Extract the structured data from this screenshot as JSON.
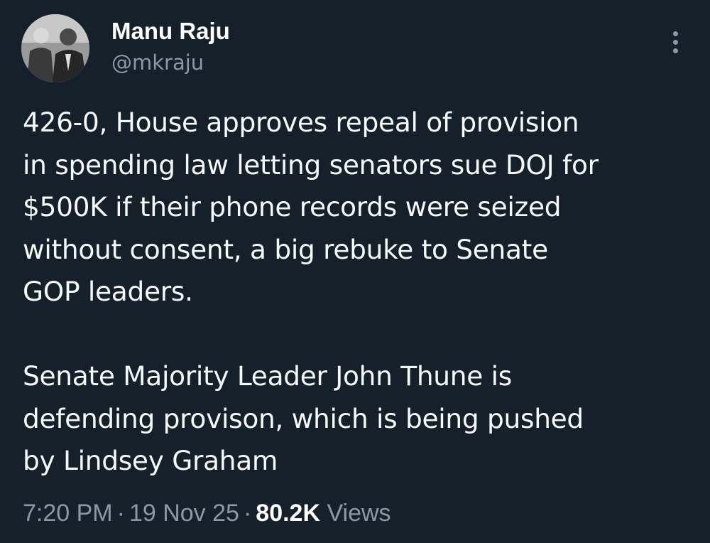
{
  "author": {
    "display_name": "Manu Raju",
    "handle": "@mkraju"
  },
  "tweet": {
    "paragraph_1": "426-0, House approves repeal of provision\nin spending law letting senators sue DOJ for\n$500K if their phone records were seized\nwithout consent, a big rebuke to Senate\nGOP leaders.",
    "paragraph_2": "Senate Majority Leader John Thune is\ndefending provison, which is being pushed\nby Lindsey Graham"
  },
  "meta": {
    "time": "7:20 PM",
    "separator": "·",
    "date": "19 Nov 25",
    "views_count": "80.2K",
    "views_label": "Views"
  },
  "icons": {
    "more": "more-vertical-icon",
    "avatar": "profile-photo"
  },
  "colors": {
    "background": "#15202b",
    "text": "#f7f9f9",
    "secondary_text": "#8b98a5"
  }
}
